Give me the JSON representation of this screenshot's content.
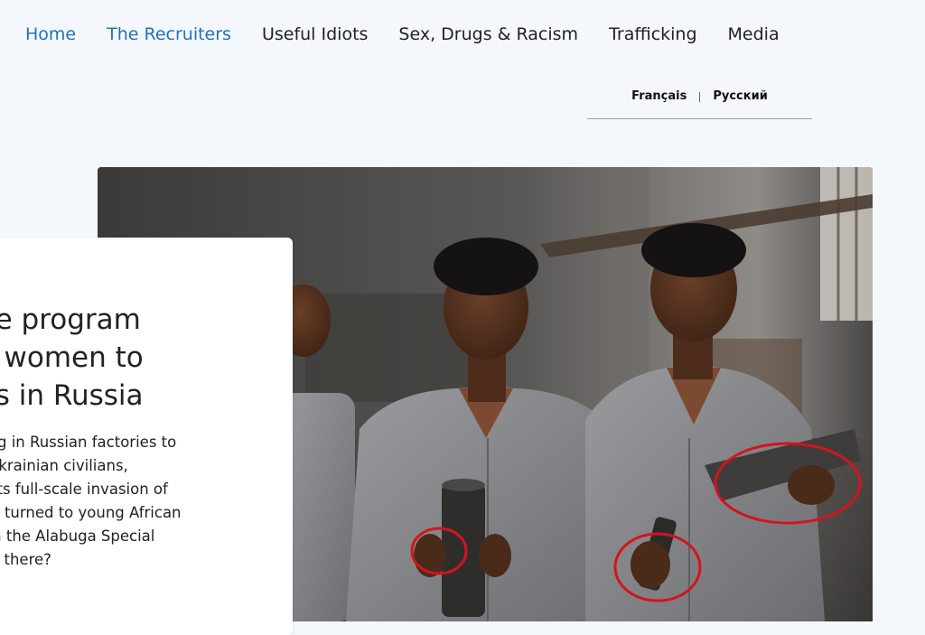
{
  "nav": {
    "items": [
      {
        "label": "Home",
        "active": true
      },
      {
        "label": "The Recruiters",
        "active": true
      },
      {
        "label": "Useful Idiots",
        "active": false
      },
      {
        "label": "Sex, Drugs & Racism",
        "active": false
      },
      {
        "label": "Trafficking",
        "active": false
      },
      {
        "label": "Media",
        "active": false
      }
    ]
  },
  "languages": {
    "french": "Français",
    "russian": "Русский"
  },
  "article": {
    "title_lines": [
      "The program",
      "an women to",
      "nes in Russia"
    ],
    "excerpt_lines": [
      "working in Russian factories to",
      "n kill Ukrainian civilians,",
      "Since its full-scale invasion of",
      "sia has turned to young African",
      "ages in the Alabuga Special",
      "end up there?"
    ]
  },
  "colors": {
    "nav_active": "#1f74b5",
    "annotation": "#d4141c",
    "page_background": "#f4f7fc"
  }
}
